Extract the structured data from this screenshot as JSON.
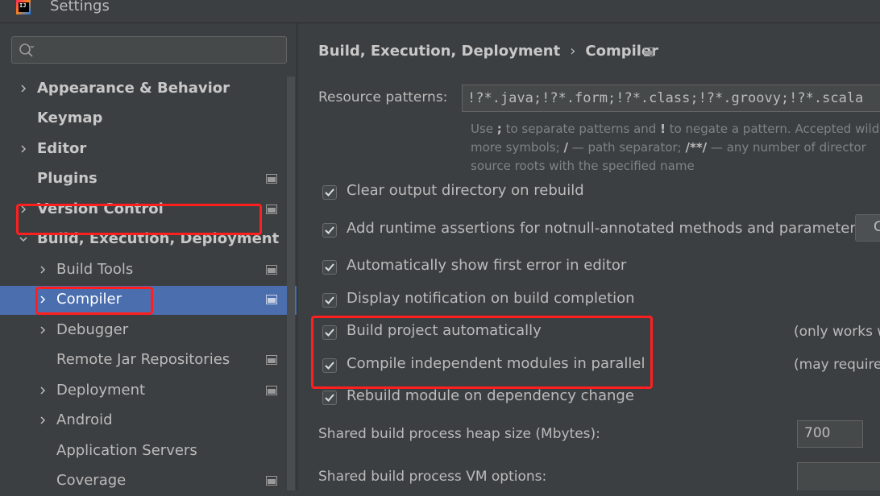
{
  "window": {
    "title": "Settings",
    "app_icon_text": "IJ"
  },
  "search": {
    "value": "",
    "placeholder": ""
  },
  "tree": {
    "items": [
      {
        "label": "Appearance & Behavior",
        "expandable": true
      },
      {
        "label": "Keymap",
        "expandable": false
      },
      {
        "label": "Editor",
        "expandable": true
      },
      {
        "label": "Plugins",
        "expandable": false
      },
      {
        "label": "Version Control",
        "expandable": true
      },
      {
        "label": "Build, Execution, Deployment",
        "expanded": true
      },
      {
        "label": "Build Tools",
        "expandable": true
      },
      {
        "label": "Compiler",
        "expandable": true,
        "selected": true
      },
      {
        "label": "Debugger",
        "expandable": true
      },
      {
        "label": "Remote Jar Repositories",
        "expandable": false
      },
      {
        "label": "Deployment",
        "expandable": true
      },
      {
        "label": "Android",
        "expandable": true
      },
      {
        "label": "Application Servers",
        "expandable": false
      },
      {
        "label": "Coverage",
        "expandable": false
      }
    ]
  },
  "breadcrumb": {
    "parent": "Build, Execution, Deployment",
    "separator": "›",
    "current": "Compiler"
  },
  "resource_patterns": {
    "label": "Resource patterns:",
    "value": "!?*.java;!?*.form;!?*.class;!?*.groovy;!?*.scala",
    "hint_line1_a": "Use ",
    "hint_line1_b": ";",
    "hint_line1_c": " to separate patterns and ",
    "hint_line1_d": "!",
    "hint_line1_e": " to negate a pattern. Accepted wild",
    "hint_line2_a": "more symbols; ",
    "hint_line2_b": "/",
    "hint_line2_c": " — path separator; ",
    "hint_line2_d": "/**/",
    "hint_line2_e": " — any number of director",
    "hint_line3": "source roots with the specified name"
  },
  "options": {
    "clear_output": "Clear output directory on rebuild",
    "runtime_assertions": "Add runtime assertions for notnull-annotated methods and parameters",
    "runtime_assertions_button": "C",
    "show_first_error": "Automatically show first error in editor",
    "display_notification": "Display notification on build completion",
    "build_automatically": "Build project automatically",
    "build_automatically_note": "(only works w",
    "compile_parallel": "Compile independent modules in parallel",
    "compile_parallel_note": "(may require",
    "rebuild_module": "Rebuild module on dependency change"
  },
  "heap": {
    "label": "Shared build process heap size (Mbytes):",
    "value": "700"
  },
  "vm_options": {
    "label": "Shared build process VM options:",
    "value": ""
  },
  "colors": {
    "highlight": "#ff1f1f",
    "selection": "#4b6eaf",
    "background": "#3c3f41"
  }
}
